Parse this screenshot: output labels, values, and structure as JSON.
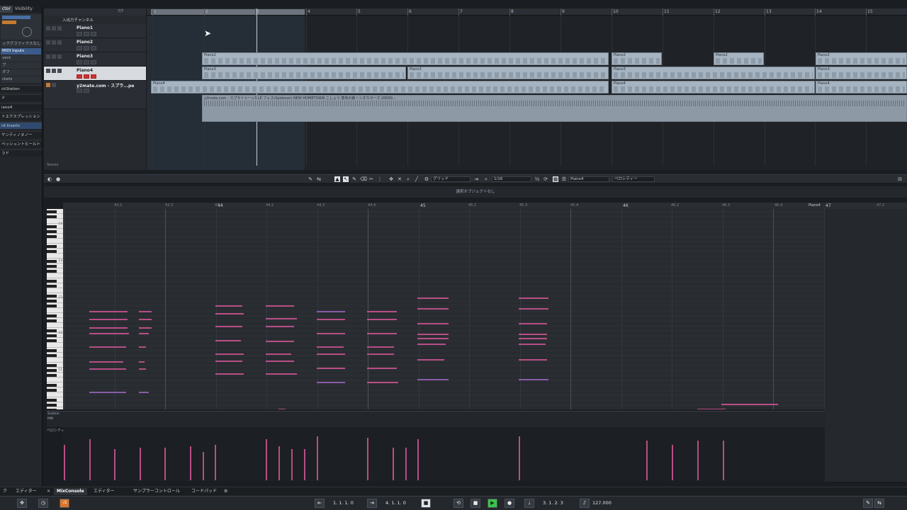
{
  "inspector": {
    "tabs": [
      {
        "label": "ctor"
      },
      {
        "label": "Visibility"
      }
    ],
    "rows": [
      "ックグラフィクスなし",
      "MIDI Inputs",
      "vent",
      "ブ",
      "オフ",
      "ckets"
    ],
    "sections": [
      "ckStation",
      "ド",
      "iano4",
      "トエクスプレッション",
      "rd Inserts",
      "ヤンティノヌノー",
      "ペッシュントヒールト",
      "ラド"
    ]
  },
  "tracklist": {
    "header": "入出力チャンネル",
    "tracks": [
      {
        "name": "Piano1",
        "selected": false
      },
      {
        "name": "Piano2",
        "selected": false
      },
      {
        "name": "Piano3",
        "selected": false
      },
      {
        "name": "Piano4",
        "selected": true
      },
      {
        "name": "y2mate.com - スプラ...pe",
        "selected": false
      }
    ],
    "counter": "7/7",
    "footer": "Stereo"
  },
  "arrange": {
    "bars": [
      "1",
      "2",
      "3",
      "4",
      "5",
      "6",
      "7",
      "8",
      "9",
      "10",
      "11",
      "12",
      "13",
      "14",
      "15"
    ],
    "clips": [
      {
        "label": "Piano2",
        "kind": "midi"
      },
      {
        "label": "Piano2",
        "kind": "midi"
      },
      {
        "label": "Piano2",
        "kind": "midi"
      },
      {
        "label": "Piano2",
        "kind": "midi"
      },
      {
        "label": "Piano3",
        "kind": "midi"
      },
      {
        "label": "Piano3",
        "kind": "midi"
      },
      {
        "label": "Piano3",
        "kind": "midi"
      },
      {
        "label": "Piano3",
        "kind": "midi"
      },
      {
        "label": "Piano4",
        "kind": "midi"
      },
      {
        "label": "Piano4",
        "kind": "midi"
      },
      {
        "label": "Piano4",
        "kind": "midi"
      },
      {
        "label": "y2mate.com - スプラトゥーン3 LE フェス(Splatoon) NEW HOMETOWN こしょう 蒸気の森 ! シオカラーズ 20000...",
        "kind": "audio"
      }
    ]
  },
  "editor": {
    "toolbar": {
      "grid_label": "グリッド",
      "quantize": "1/16",
      "track_field": "Piano4",
      "lane_field": "ベロシティー"
    },
    "status": "選択オブジェクトなし",
    "ruler": {
      "bars": [
        "44",
        "45",
        "46",
        "47"
      ],
      "subs": [
        "43.2",
        "43.3",
        "43.4",
        "44.2",
        "44.3",
        "44.4",
        "45.2",
        "45.3",
        "45.4",
        "46.2",
        "46.3",
        "46.4",
        "47.2"
      ],
      "end_label": "Piano4"
    },
    "key_labels": [
      "C5",
      "C4",
      "C3",
      "C2",
      "C1"
    ],
    "lane_labels": [
      "Sustain",
      "MW"
    ],
    "velocity_label": "ベロシティー"
  },
  "bottom_tabs": [
    {
      "label": "ク"
    },
    {
      "label": "エディター"
    },
    {
      "label": "MixConsole"
    },
    {
      "label": "エディター"
    },
    {
      "label": "サンプラーコントロール"
    },
    {
      "label": "コードパッド"
    }
  ],
  "transport": {
    "left_locator": "1. 1. 1. 0",
    "right_locator": "4. 1. 1. 0",
    "position": "3. 1. 2. 3",
    "tempo": "127.000",
    "badge": "-/1"
  },
  "colors": {
    "note_magenta": "#b94e86",
    "note_purple": "#8a5aa8",
    "clip_blue": "#a6b3c1",
    "play_green": "#3cc34d",
    "record_red": "#c33"
  }
}
